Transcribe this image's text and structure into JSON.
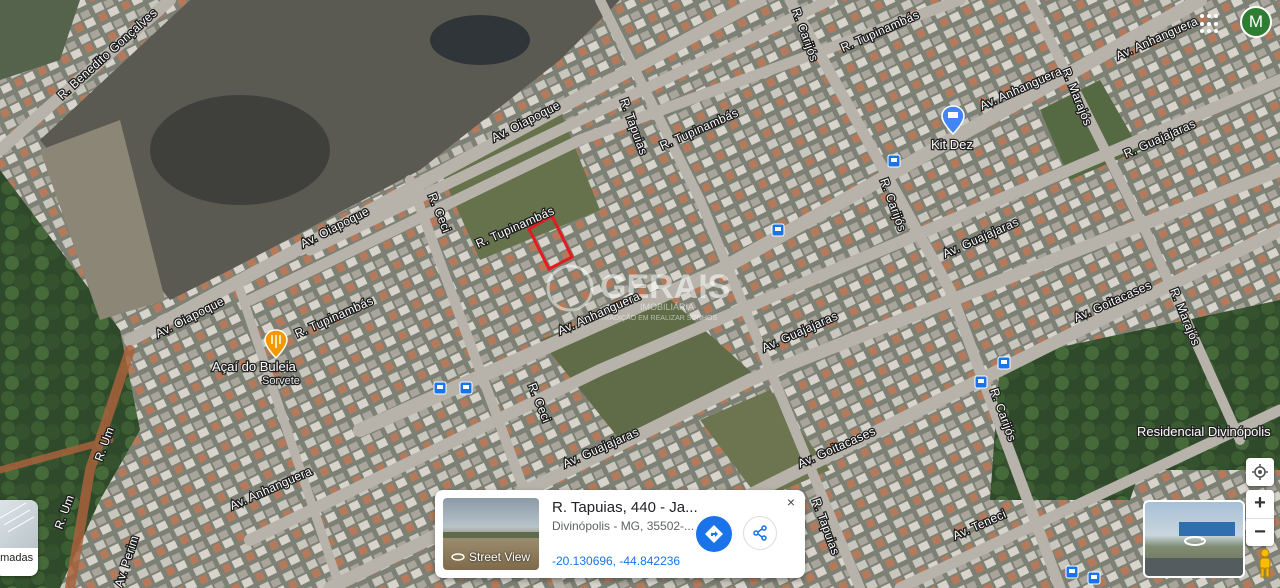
{
  "map": {
    "streets": [
      {
        "id": "benedito",
        "label": "R. Benedito Gonçalves"
      },
      {
        "id": "oiapoque_top",
        "label": "Av. Oiapoque"
      },
      {
        "id": "oiapoque_mid",
        "label": "Av. Oiapoque"
      },
      {
        "id": "oiapoque_low",
        "label": "Av. Oiapoque"
      },
      {
        "id": "tupinambas_top",
        "label": "R. Tupinambás"
      },
      {
        "id": "tupinambas_mid",
        "label": "R. Tupinambás"
      },
      {
        "id": "tupinambas_center",
        "label": "R. Tupinambás"
      },
      {
        "id": "tupinambas_left",
        "label": "R. Tupinambás"
      },
      {
        "id": "carijos_top",
        "label": "R. Carijós"
      },
      {
        "id": "carijos_mid",
        "label": "R. Carijós"
      },
      {
        "id": "carijos_low",
        "label": "R. Carijós"
      },
      {
        "id": "tapuias_top",
        "label": "R. Tapuias"
      },
      {
        "id": "tapuias_low",
        "label": "R. Tapuias"
      },
      {
        "id": "anhanguera_tr",
        "label": "Av. Anhanguera"
      },
      {
        "id": "anhanguera_mr",
        "label": "Av. Anhanguera"
      },
      {
        "id": "anhanguera_c",
        "label": "Av. Anhanguera"
      },
      {
        "id": "anhanguera_l",
        "label": "Av. Anhanguera"
      },
      {
        "id": "marajos_top",
        "label": "R. Marajós"
      },
      {
        "id": "marajos_low",
        "label": "R. Marajós"
      },
      {
        "id": "guajajaras_tr",
        "label": "R. Guajajaras"
      },
      {
        "id": "guajajaras_r",
        "label": "Av. Guajajaras"
      },
      {
        "id": "guajajaras_c",
        "label": "Av. Guajajaras"
      },
      {
        "id": "guajajaras_l",
        "label": "Av. Guajajaras"
      },
      {
        "id": "goitacases_r",
        "label": "Av. Goitacases"
      },
      {
        "id": "goitacases_c",
        "label": "Av. Goitacases"
      },
      {
        "id": "ceci_top",
        "label": "R. Ceci"
      },
      {
        "id": "ceci_low",
        "label": "R. Ceci"
      },
      {
        "id": "um_top",
        "label": "R. Um"
      },
      {
        "id": "um_low",
        "label": "R. Um"
      },
      {
        "id": "perim",
        "label": "Av. Perim"
      },
      {
        "id": "teneci",
        "label": "Av. Teneci"
      }
    ],
    "pois": {
      "kit_dez": "Kit Dez",
      "acai_name": "Açaí do Buleia",
      "acai_category": "Sorvete",
      "residencial": "Residencial Divinópolis"
    },
    "watermark": {
      "brand": "GERAIS",
      "line1": "IMOBILIÁRIA",
      "line2": "TRADIÇÃO EM REALIZAR SONHOS"
    },
    "layers_label": "amadas"
  },
  "account": {
    "avatar_letter": "M"
  },
  "place_card": {
    "address": "R. Tapuias, 440 - Ja...",
    "locality": "Divinópolis - MG, 35502-...",
    "coordinates": "-20.130696, -44.842236",
    "street_view_label": "Street View",
    "close_symbol": "×"
  },
  "controls": {
    "zoom_in": "+",
    "zoom_out": "−"
  },
  "colors": {
    "accent": "#1a73e8",
    "highlight": "#e8191f",
    "poi_orange": "#f29900",
    "poi_blue": "#4285f4",
    "avatar": "#2e7d32"
  }
}
